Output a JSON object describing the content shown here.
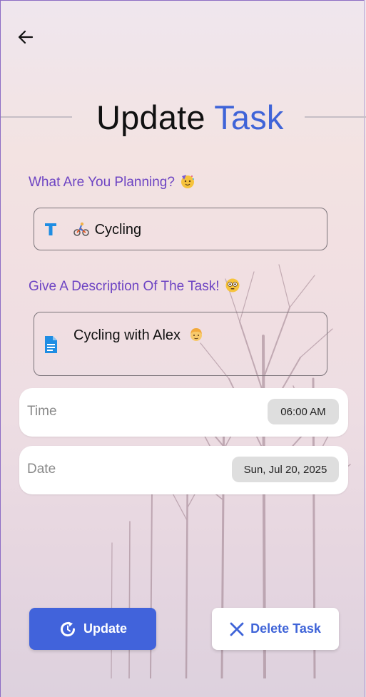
{
  "header": {
    "title_main": "Update",
    "title_accent": "Task"
  },
  "form": {
    "title_label": "What Are You Planning?",
    "title_label_emoji": "partying-face",
    "title_value": "Cycling",
    "title_value_emoji": "person-biking",
    "description_label": "Give A Description Of The Task!",
    "description_label_emoji": "flushed-face",
    "description_value": "Cycling with Alex",
    "description_value_emoji": "person-blond"
  },
  "time": {
    "label": "Time",
    "value": "06:00 AM"
  },
  "date": {
    "label": "Date",
    "value": "Sun, Jul 20, 2025"
  },
  "actions": {
    "update_label": "Update",
    "delete_label": "Delete Task"
  },
  "colors": {
    "accent": "#4163db",
    "label_purple": "#6d44c3"
  },
  "icons": {
    "back": "arrow-left-icon",
    "title_field": "text-format-icon",
    "description_field": "document-icon",
    "update": "refresh-icon",
    "delete": "close-icon"
  }
}
